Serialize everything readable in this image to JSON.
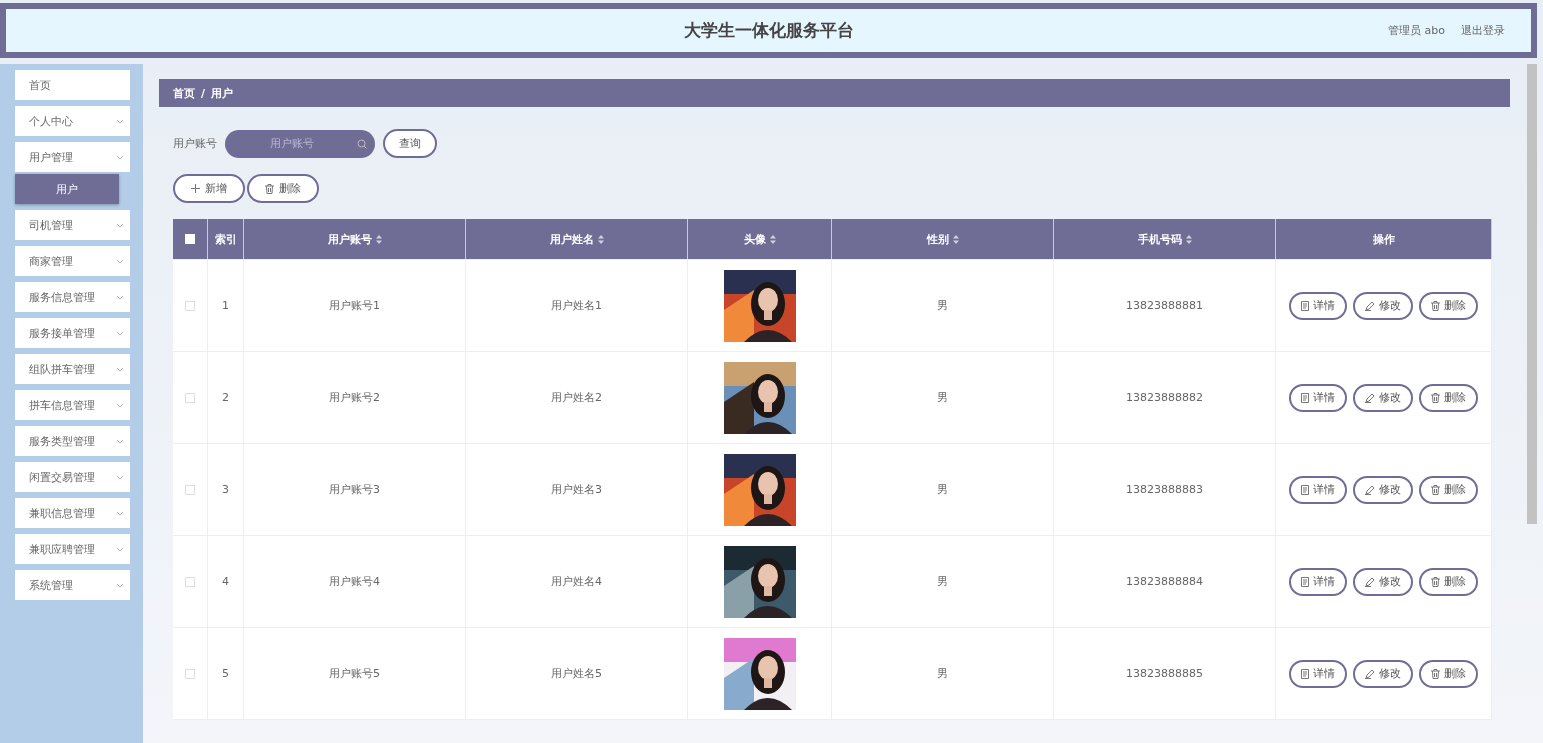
{
  "header": {
    "title": "大学生一体化服务平台",
    "user": "管理员 abo",
    "logout": "退出登录"
  },
  "sidebar": {
    "items": [
      {
        "label": "首页",
        "submenu": false
      },
      {
        "label": "个人中心",
        "submenu": true
      },
      {
        "label": "用户管理",
        "submenu": true,
        "children": [
          {
            "label": "用户",
            "selected": true
          }
        ]
      },
      {
        "label": "司机管理",
        "submenu": true
      },
      {
        "label": "商家管理",
        "submenu": true
      },
      {
        "label": "服务信息管理",
        "submenu": true
      },
      {
        "label": "服务接单管理",
        "submenu": true
      },
      {
        "label": "组队拼车管理",
        "submenu": true
      },
      {
        "label": "拼车信息管理",
        "submenu": true
      },
      {
        "label": "服务类型管理",
        "submenu": true
      },
      {
        "label": "闲置交易管理",
        "submenu": true
      },
      {
        "label": "兼职信息管理",
        "submenu": true
      },
      {
        "label": "兼职应聘管理",
        "submenu": true
      },
      {
        "label": "系统管理",
        "submenu": true
      }
    ]
  },
  "breadcrumb": [
    "首页",
    "/",
    "用户"
  ],
  "search": {
    "label": "用户账号",
    "placeholder": "用户账号",
    "button": "查询"
  },
  "actions": [
    {
      "kind": "add",
      "label": "新增"
    },
    {
      "kind": "delete",
      "label": "删除"
    }
  ],
  "table": {
    "select_all": {
      "checked": false
    },
    "columns": [
      {
        "label": "索引",
        "sortable": false
      },
      {
        "label": "用户账号",
        "sortable": true
      },
      {
        "label": "用户姓名",
        "sortable": true
      },
      {
        "label": "头像",
        "sortable": true
      },
      {
        "label": "性别",
        "sortable": true
      },
      {
        "label": "手机号码",
        "sortable": true
      },
      {
        "label": "操作",
        "sortable": false
      }
    ],
    "rows": [
      {
        "checked": false,
        "index": "1",
        "account": "用户账号1",
        "name": "用户姓名1",
        "gender": "男",
        "phone": "13823888881",
        "buttons": [
          {
            "kind": "detail",
            "label": "详情"
          },
          {
            "kind": "edit",
            "label": "修改"
          },
          {
            "kind": "delete",
            "label": "删除"
          }
        ]
      },
      {
        "checked": false,
        "index": "2",
        "account": "用户账号2",
        "name": "用户姓名2",
        "gender": "男",
        "phone": "13823888882",
        "buttons": [
          {
            "kind": "detail",
            "label": "详情"
          },
          {
            "kind": "edit",
            "label": "修改"
          },
          {
            "kind": "delete",
            "label": "删除"
          }
        ]
      },
      {
        "checked": false,
        "index": "3",
        "account": "用户账号3",
        "name": "用户姓名3",
        "gender": "男",
        "phone": "13823888883",
        "buttons": [
          {
            "kind": "detail",
            "label": "详情"
          },
          {
            "kind": "edit",
            "label": "修改"
          },
          {
            "kind": "delete",
            "label": "删除"
          }
        ]
      },
      {
        "checked": false,
        "index": "4",
        "account": "用户账号4",
        "name": "用户姓名4",
        "gender": "男",
        "phone": "13823888884",
        "buttons": [
          {
            "kind": "detail",
            "label": "详情"
          },
          {
            "kind": "edit",
            "label": "修改"
          },
          {
            "kind": "delete",
            "label": "删除"
          }
        ]
      },
      {
        "checked": false,
        "index": "5",
        "account": "用户账号5",
        "name": "用户姓名5",
        "gender": "男",
        "phone": "13823888885",
        "buttons": [
          {
            "kind": "detail",
            "label": "详情"
          },
          {
            "kind": "edit",
            "label": "修改"
          },
          {
            "kind": "delete",
            "label": "删除"
          }
        ]
      }
    ]
  }
}
